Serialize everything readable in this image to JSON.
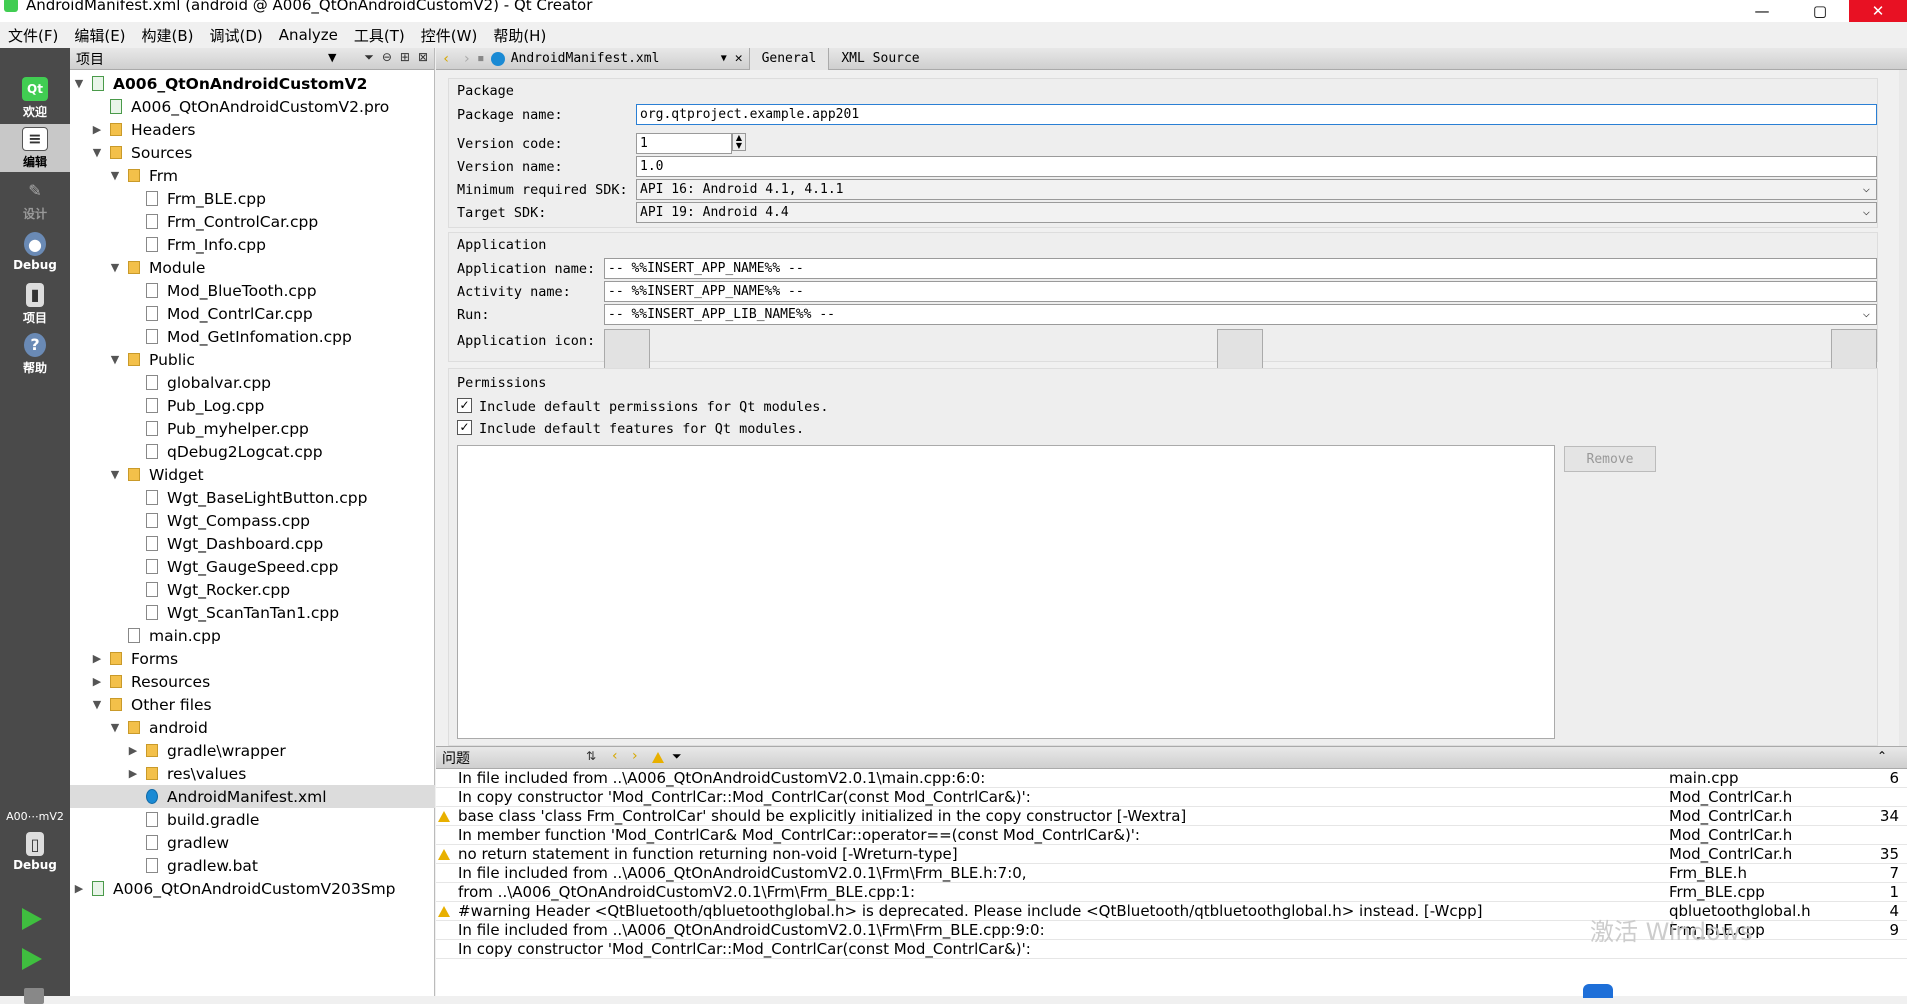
{
  "window": {
    "title": "AndroidManifest.xml (android @ A006_QtOnAndroidCustomV2) - Qt Creator",
    "controls": [
      "—",
      "▢",
      "✕"
    ]
  },
  "menu": [
    "文件(F)",
    "编辑(E)",
    "构建(B)",
    "调试(D)",
    "Analyze",
    "工具(T)",
    "控件(W)",
    "帮助(H)"
  ],
  "modes": [
    {
      "label": "欢迎",
      "icon": "qt-logo-icon"
    },
    {
      "label": "编辑",
      "icon": "edit-icon"
    },
    {
      "label": "设计",
      "icon": "design-icon"
    },
    {
      "label": "Debug",
      "icon": "debug-icon"
    },
    {
      "label": "项目",
      "icon": "project-icon"
    },
    {
      "label": "帮助",
      "icon": "help-icon"
    }
  ],
  "kit": {
    "label": "A00⋯mV2",
    "mode": "Debug"
  },
  "project_pane": {
    "title": "项目",
    "tree": [
      {
        "label": "A006_QtOnAndroidCustomV2",
        "depth": 0,
        "arrow": "▼",
        "icon": "pro",
        "bold": true
      },
      {
        "label": "A006_QtOnAndroidCustomV2.pro",
        "depth": 1,
        "arrow": "",
        "icon": "pro"
      },
      {
        "label": "Headers",
        "depth": 1,
        "arrow": "▶",
        "icon": "folder"
      },
      {
        "label": "Sources",
        "depth": 1,
        "arrow": "▼",
        "icon": "folder"
      },
      {
        "label": "Frm",
        "depth": 2,
        "arrow": "▼",
        "icon": "folder"
      },
      {
        "label": "Frm_BLE.cpp",
        "depth": 3,
        "arrow": "",
        "icon": "file"
      },
      {
        "label": "Frm_ControlCar.cpp",
        "depth": 3,
        "arrow": "",
        "icon": "file"
      },
      {
        "label": "Frm_Info.cpp",
        "depth": 3,
        "arrow": "",
        "icon": "file"
      },
      {
        "label": "Module",
        "depth": 2,
        "arrow": "▼",
        "icon": "folder"
      },
      {
        "label": "Mod_BlueTooth.cpp",
        "depth": 3,
        "arrow": "",
        "icon": "file"
      },
      {
        "label": "Mod_ContrlCar.cpp",
        "depth": 3,
        "arrow": "",
        "icon": "file"
      },
      {
        "label": "Mod_GetInfomation.cpp",
        "depth": 3,
        "arrow": "",
        "icon": "file"
      },
      {
        "label": "Public",
        "depth": 2,
        "arrow": "▼",
        "icon": "folder"
      },
      {
        "label": "globalvar.cpp",
        "depth": 3,
        "arrow": "",
        "icon": "file"
      },
      {
        "label": "Pub_Log.cpp",
        "depth": 3,
        "arrow": "",
        "icon": "file"
      },
      {
        "label": "Pub_myhelper.cpp",
        "depth": 3,
        "arrow": "",
        "icon": "file"
      },
      {
        "label": "qDebug2Logcat.cpp",
        "depth": 3,
        "arrow": "",
        "icon": "file"
      },
      {
        "label": "Widget",
        "depth": 2,
        "arrow": "▼",
        "icon": "folder"
      },
      {
        "label": "Wgt_BaseLightButton.cpp",
        "depth": 3,
        "arrow": "",
        "icon": "file"
      },
      {
        "label": "Wgt_Compass.cpp",
        "depth": 3,
        "arrow": "",
        "icon": "file"
      },
      {
        "label": "Wgt_Dashboard.cpp",
        "depth": 3,
        "arrow": "",
        "icon": "file"
      },
      {
        "label": "Wgt_GaugeSpeed.cpp",
        "depth": 3,
        "arrow": "",
        "icon": "file"
      },
      {
        "label": "Wgt_Rocker.cpp",
        "depth": 3,
        "arrow": "",
        "icon": "file"
      },
      {
        "label": "Wgt_ScanTanTan1.cpp",
        "depth": 3,
        "arrow": "",
        "icon": "file"
      },
      {
        "label": "main.cpp",
        "depth": 2,
        "arrow": "",
        "icon": "file"
      },
      {
        "label": "Forms",
        "depth": 1,
        "arrow": "▶",
        "icon": "folder"
      },
      {
        "label": "Resources",
        "depth": 1,
        "arrow": "▶",
        "icon": "folder"
      },
      {
        "label": "Other files",
        "depth": 1,
        "arrow": "▼",
        "icon": "folder"
      },
      {
        "label": "android",
        "depth": 2,
        "arrow": "▼",
        "icon": "folder"
      },
      {
        "label": "gradle\\wrapper",
        "depth": 3,
        "arrow": "▶",
        "icon": "folder"
      },
      {
        "label": "res\\values",
        "depth": 3,
        "arrow": "▶",
        "icon": "folder"
      },
      {
        "label": "AndroidManifest.xml",
        "depth": 3,
        "arrow": "",
        "icon": "xml",
        "selected": true
      },
      {
        "label": "build.gradle",
        "depth": 3,
        "arrow": "",
        "icon": "file"
      },
      {
        "label": "gradlew",
        "depth": 3,
        "arrow": "",
        "icon": "file"
      },
      {
        "label": "gradlew.bat",
        "depth": 3,
        "arrow": "",
        "icon": "file"
      },
      {
        "label": "A006_QtOnAndroidCustomV203Smp",
        "depth": 0,
        "arrow": "▶",
        "icon": "pro"
      }
    ]
  },
  "editor": {
    "file_name": "AndroidManifest.xml",
    "tabs": [
      "General",
      "XML Source"
    ],
    "package": {
      "title": "Package",
      "name_label": "Package name:",
      "name_value": "org.qtproject.example.app201",
      "version_code_label": "Version code:",
      "version_code_value": "1",
      "version_name_label": "Version name:",
      "version_name_value": "1.0",
      "min_sdk_label": "Minimum required SDK:",
      "min_sdk_value": "API 16: Android 4.1, 4.1.1",
      "target_sdk_label": "Target SDK:",
      "target_sdk_value": "API 19: Android 4.4"
    },
    "application": {
      "title": "Application",
      "app_name_label": "Application name:",
      "app_name_value": "-- %%INSERT_APP_NAME%% --",
      "activity_name_label": "Activity name:",
      "activity_name_value": "-- %%INSERT_APP_NAME%% --",
      "run_label": "Run:",
      "run_value": "-- %%INSERT_APP_LIB_NAME%% --",
      "icon_label": "Application icon:"
    },
    "permissions": {
      "title": "Permissions",
      "include_permissions": "Include default permissions for Qt modules.",
      "include_features": "Include default features for Qt modules.",
      "remove_label": "Remove"
    }
  },
  "issues": {
    "title": "问题",
    "rows": [
      {
        "warn": false,
        "msg": "In file included from ..\\A006_QtOnAndroidCustomV2.0.1\\main.cpp:6:0:",
        "file": "main.cpp",
        "line": "6"
      },
      {
        "warn": false,
        "msg": "In copy constructor 'Mod_ContrlCar::Mod_ContrlCar(const Mod_ContrlCar&)':",
        "file": "Mod_ContrlCar.h",
        "line": ""
      },
      {
        "warn": true,
        "msg": "base class 'class Frm_ControlCar' should be explicitly initialized in the copy constructor [-Wextra]",
        "file": "Mod_ContrlCar.h",
        "line": "34"
      },
      {
        "warn": false,
        "msg": "In member function 'Mod_ContrlCar& Mod_ContrlCar::operator==(const Mod_ContrlCar&)':",
        "file": "Mod_ContrlCar.h",
        "line": ""
      },
      {
        "warn": true,
        "msg": "no return statement in function returning non-void [-Wreturn-type]",
        "file": "Mod_ContrlCar.h",
        "line": "35"
      },
      {
        "warn": false,
        "msg": "In file included from ..\\A006_QtOnAndroidCustomV2.0.1\\Frm\\Frm_BLE.h:7:0,",
        "file": "Frm_BLE.h",
        "line": "7"
      },
      {
        "warn": false,
        "msg": "from ..\\A006_QtOnAndroidCustomV2.0.1\\Frm\\Frm_BLE.cpp:1:",
        "file": "Frm_BLE.cpp",
        "line": "1"
      },
      {
        "warn": true,
        "msg": "#warning Header <QtBluetooth/qbluetoothglobal.h> is deprecated. Please include <QtBluetooth/qtbluetoothglobal.h> instead. [-Wcpp]",
        "file": "qbluetoothglobal.h",
        "line": "4"
      },
      {
        "warn": false,
        "msg": "In file included from ..\\A006_QtOnAndroidCustomV2.0.1\\Frm\\Frm_BLE.cpp:9:0:",
        "file": "Frm_BLE.cpp",
        "line": "9"
      },
      {
        "warn": false,
        "msg": "In copy constructor 'Mod_ContrlCar::Mod_ContrlCar(const Mod_ContrlCar&)':",
        "file": "",
        "line": ""
      }
    ]
  },
  "overlay": {
    "watermark": "激活 Windows"
  }
}
